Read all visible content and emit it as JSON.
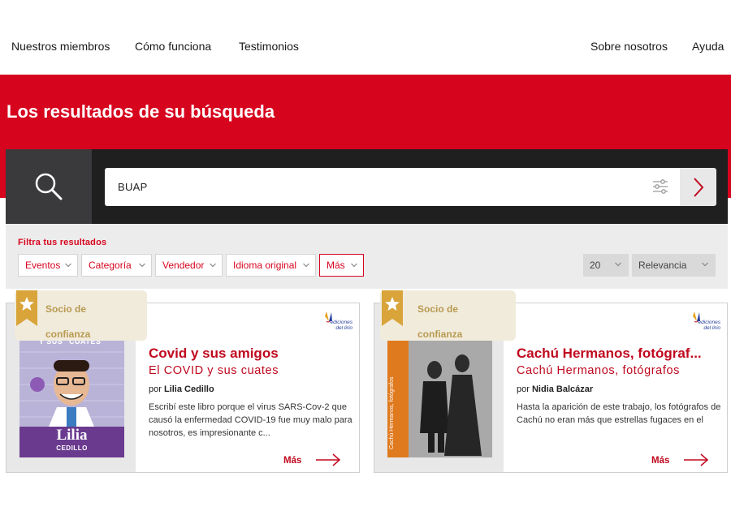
{
  "nav": {
    "left": [
      "Nuestros miembros",
      "Cómo funciona",
      "Testimonios"
    ],
    "right": [
      "Sobre nosotros",
      "Ayuda"
    ]
  },
  "banner": {
    "title": "Los resultados de su búsqueda"
  },
  "search": {
    "value": "BUAP"
  },
  "filters": {
    "title": "Filtra tus resultados",
    "buttons": [
      "Eventos",
      "Categoría",
      "Vendedor",
      "Idioma original",
      "Más"
    ],
    "per_page": "20",
    "sort": "Relevancia"
  },
  "colors": {
    "brand_red": "#d7041e",
    "dark": "#201f1f",
    "badge_bg": "#f1ebdc",
    "badge_gold": "#d9a43a"
  },
  "results": [
    {
      "badge": "Socio de confianza",
      "title": "Covid y sus amigos",
      "subtitle": "El COVID y sus cuates",
      "author_prefix": "por",
      "author": "Lilia Cedillo",
      "description": "Escribí este libro porque el virus SARS-Cov-2 que causó la enfermedad COVID-19 fue muy malo para nosotros, es impresionante c...",
      "more": "Más",
      "cover_text_top": "Y SUS \"CUATES\"",
      "cover_text_name": "Lilia",
      "cover_text_surname": "CEDILLO"
    },
    {
      "badge": "Socio de confianza",
      "title": "Cachú Hermanos, fotógraf...",
      "subtitle": "Cachú Hermanos, fotógrafos",
      "author_prefix": "por",
      "author": "Nidia Balcázar",
      "description": "Hasta la aparición de este trabajo, los fotógrafos de Cachú no eran más que estrellas fugaces en el",
      "more": "Más",
      "cover_spine_text": "Cachú Hermanos, fotógrafos"
    }
  ],
  "publisher": {
    "name_line1": "ediciones",
    "name_line2": "del lirio"
  },
  "icons": [
    "search-icon",
    "filter-sliders-icon",
    "chevron-right-icon",
    "chevron-down-icon",
    "star-ribbon-icon",
    "arrow-right-icon"
  ]
}
